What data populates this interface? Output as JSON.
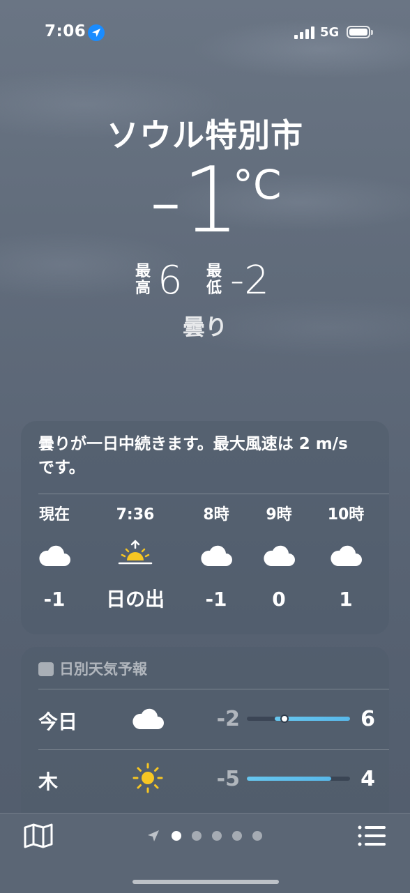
{
  "status_bar": {
    "time": "7:06",
    "network": "5G",
    "icons": [
      "location-arrow-icon",
      "signal-bars-icon",
      "battery-icon"
    ]
  },
  "header": {
    "city": "ソウル特別市",
    "current_temp": "-1",
    "unit": "°C",
    "high_label": "最高",
    "high_value": "6",
    "low_label": "最低",
    "low_value": "-2",
    "condition": "曇り"
  },
  "hourly": {
    "summary": "曇りが一日中続きます。最大風速は 2 m/s です。",
    "items": [
      {
        "label": "現在",
        "icon": "cloud-icon",
        "value": "-1"
      },
      {
        "label": "7:36",
        "icon": "sunrise-icon",
        "value": "日の出"
      },
      {
        "label": "8時",
        "icon": "cloud-icon",
        "value": "-1"
      },
      {
        "label": "9時",
        "icon": "cloud-icon",
        "value": "0"
      },
      {
        "label": "10時",
        "icon": "cloud-icon",
        "value": "1"
      }
    ]
  },
  "daily": {
    "header": "日別天気予報",
    "range_min": -5,
    "range_max": 6,
    "rows": [
      {
        "day": "今日",
        "icon": "cloud-icon",
        "low": "-2",
        "high": "6",
        "current": -1
      },
      {
        "day": "木",
        "icon": "sun-icon",
        "low": "-5",
        "high": "4"
      }
    ]
  },
  "bottom_bar": {
    "icons": [
      "map-icon",
      "location-arrow-icon",
      "list-icon"
    ],
    "page_count": 5,
    "active_page": 0
  },
  "colors": {
    "accent_blue": "#1a8cff",
    "sun_yellow": "#f7c623",
    "temp_bar": "#5fbfec"
  }
}
